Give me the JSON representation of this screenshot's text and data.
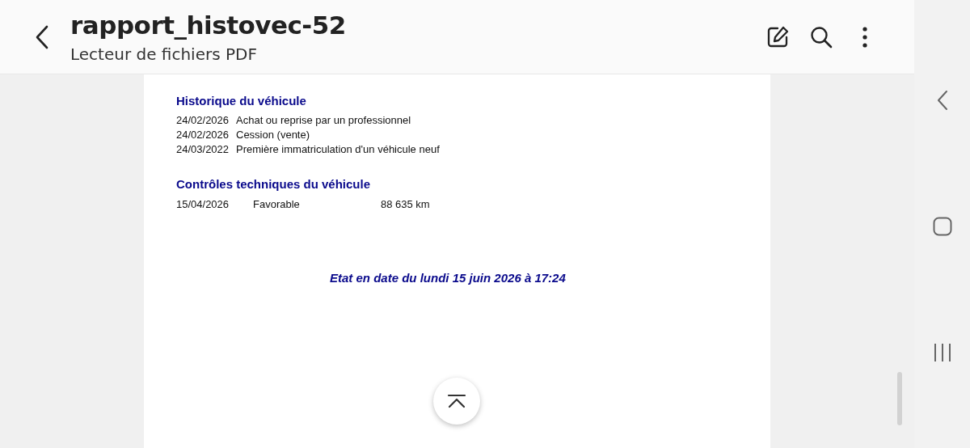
{
  "header": {
    "title": "rapport_histovec-52",
    "subtitle": "Lecteur de fichiers PDF"
  },
  "document": {
    "history_heading": "Historique du véhicule",
    "history": [
      {
        "date": "24/02/2026",
        "event": "Achat ou reprise par un professionnel"
      },
      {
        "date": "24/02/2026",
        "event": "Cession (vente)"
      },
      {
        "date": "24/03/2022",
        "event": "Première immatriculation d'un véhicule neuf"
      }
    ],
    "inspections_heading": "Contrôles techniques du véhicule",
    "inspections": [
      {
        "date": "15/04/2026",
        "result": "Favorable",
        "mileage": "88 635 km"
      }
    ],
    "status_line": "Etat en date du lundi 15 juin 2026 à 17:24"
  }
}
